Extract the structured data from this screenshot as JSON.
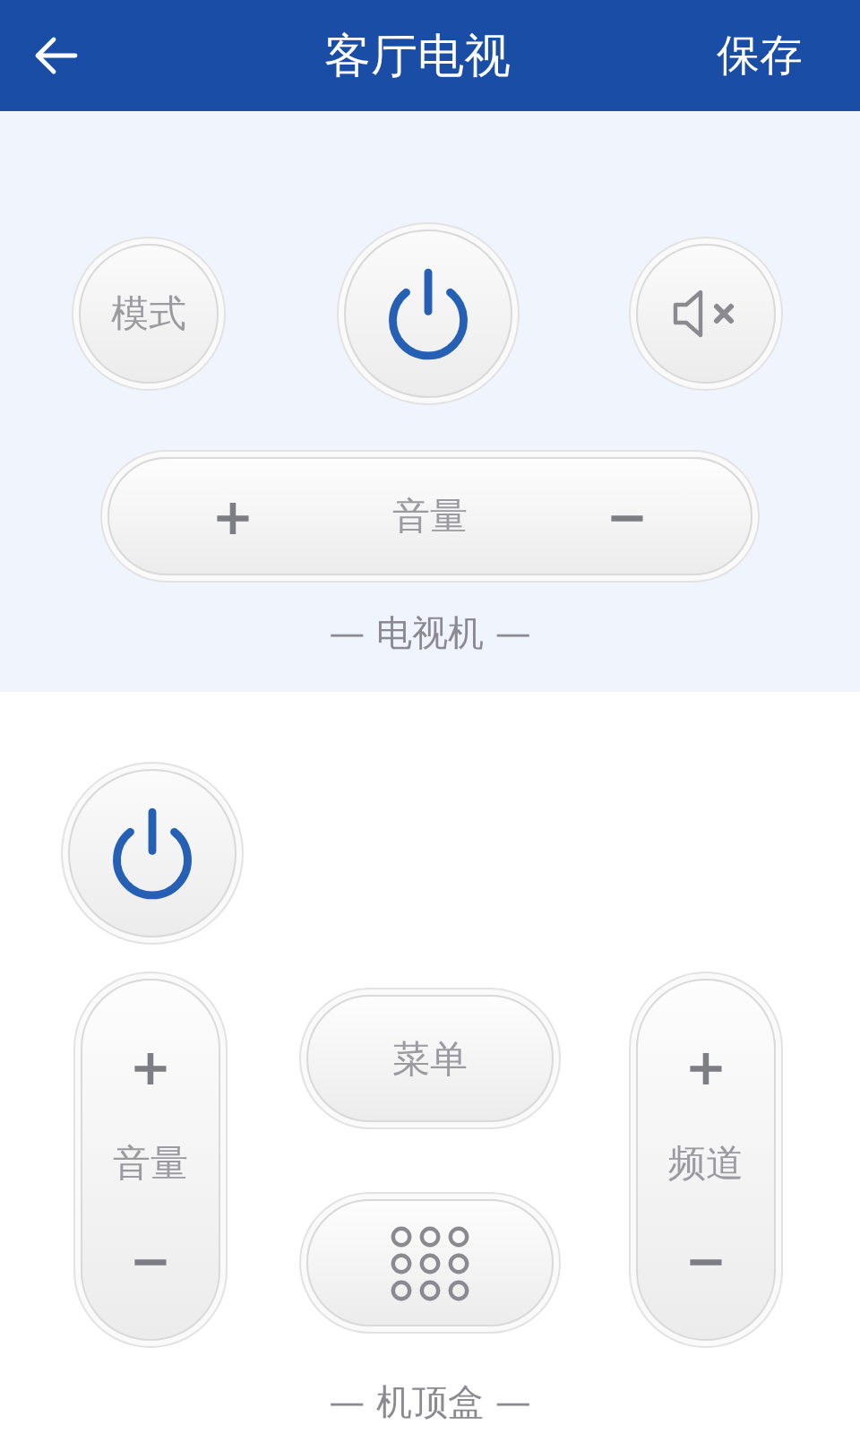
{
  "header": {
    "title": "客厅电视",
    "save_button": "保存"
  },
  "tv": {
    "mode_button": "模式",
    "volume": {
      "plus": "+",
      "label": "音量",
      "minus": "−"
    },
    "label": "— 电视机 —"
  },
  "set_top_box": {
    "volume": {
      "plus": "+",
      "label": "音量",
      "minus": "−"
    },
    "menu_button": "菜单",
    "channel": {
      "plus": "+",
      "label": "频道",
      "minus": "−"
    },
    "label": "— 机顶盒 —"
  }
}
